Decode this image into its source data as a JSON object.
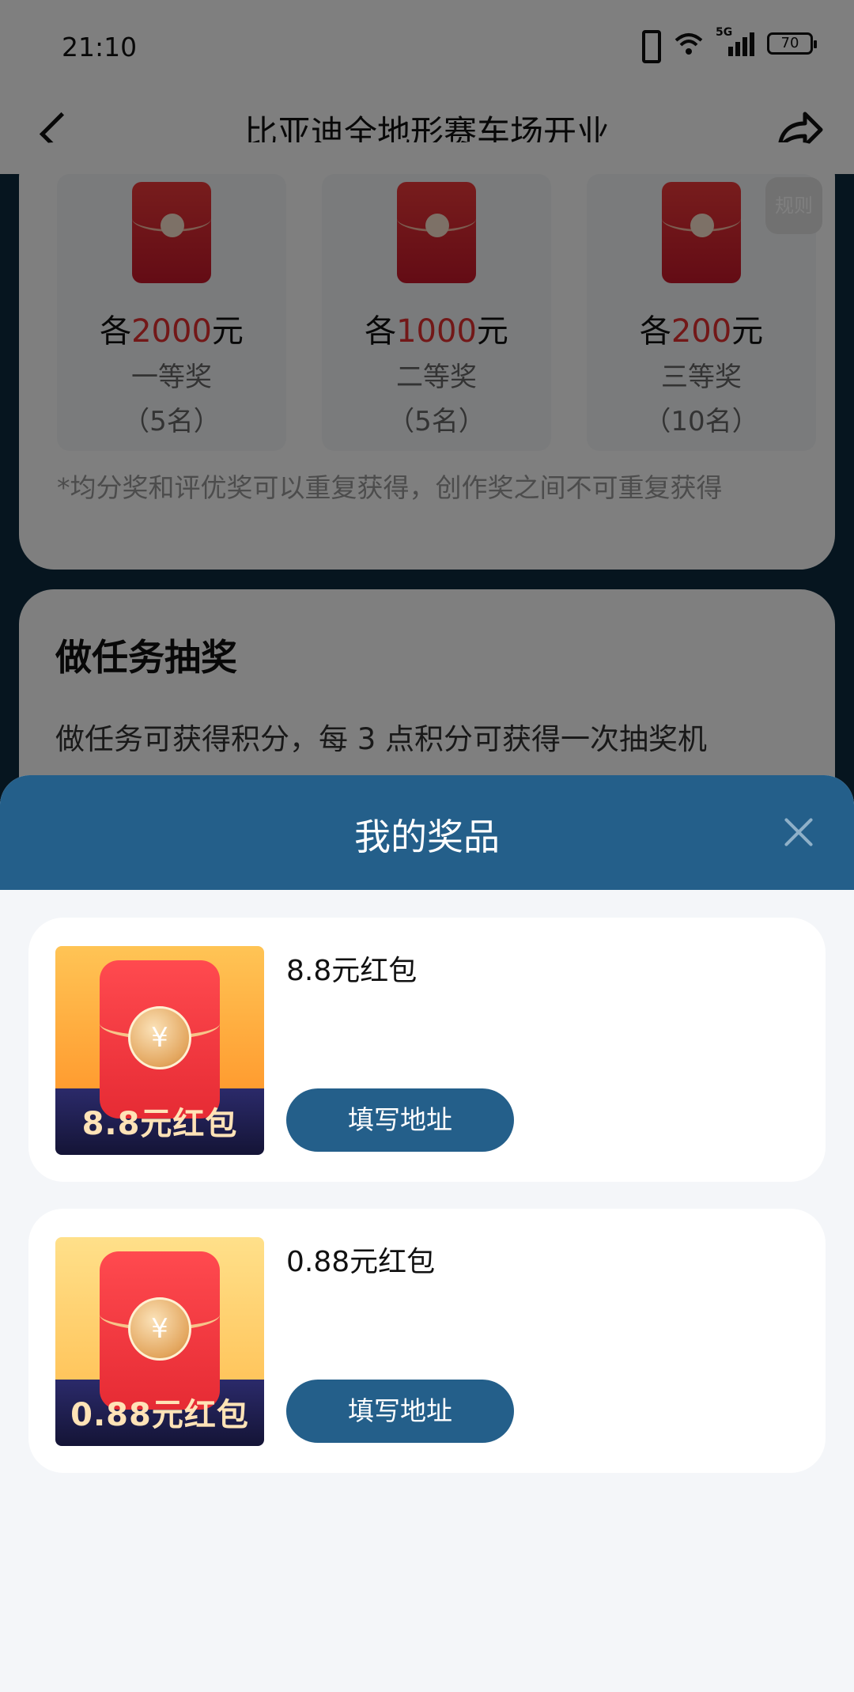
{
  "status_bar": {
    "time": "21:10",
    "battery": "70",
    "network": "5G"
  },
  "header": {
    "title": "比亚迪全地形赛车场开业"
  },
  "prize_card": {
    "prizes": [
      {
        "prefix": "各",
        "amount": "2000",
        "unit": "元",
        "level": "一等奖",
        "count": "（5名）"
      },
      {
        "prefix": "各",
        "amount": "1000",
        "unit": "元",
        "level": "二等奖",
        "count": "（5名）"
      },
      {
        "prefix": "各",
        "amount": "200",
        "unit": "元",
        "level": "三等奖",
        "count": "（10名）"
      }
    ],
    "rules_label": "规则",
    "note": "*均分奖和评优奖可以重复获得，创作奖之间不可重复获得"
  },
  "task_card": {
    "title": "做任务抽奖",
    "desc": "做任务可获得积分，每 3 点积分可获得一次抽奖机"
  },
  "sheet": {
    "title": "我的奖品",
    "items": [
      {
        "name": "8.8元红包",
        "image_label": "8.8元红包",
        "button": "填写地址",
        "top_color": "#ffb541"
      },
      {
        "name": "0.88元红包",
        "image_label": "0.88元红包",
        "button": "填写地址",
        "top_color": "#ffcf6a"
      }
    ]
  }
}
